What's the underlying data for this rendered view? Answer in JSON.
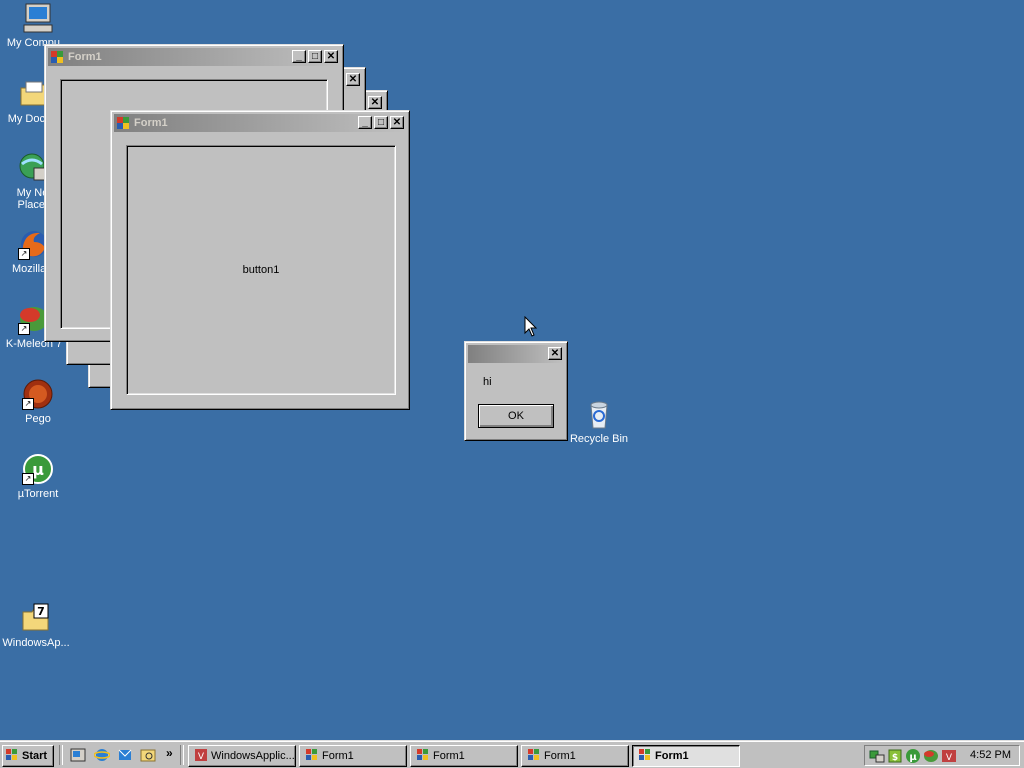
{
  "desktop": {
    "icons": [
      {
        "label": "My Compu..."
      },
      {
        "label": "My Docu..."
      },
      {
        "label": "My Net"
      },
      {
        "label": "Places"
      },
      {
        "label": "Mozilla F"
      },
      {
        "label": "K-Meleon 7"
      },
      {
        "label": "Pego"
      },
      {
        "label": "µTorrent"
      },
      {
        "label": "WindowsAp..."
      },
      {
        "label": "Recycle Bin"
      }
    ]
  },
  "windows": {
    "back_title": "Form1",
    "front_title": "Form1",
    "front_button_label": "button1",
    "controls": {
      "minimize": "_",
      "maximize": "□",
      "close": "✕"
    }
  },
  "dialog": {
    "message": "hi",
    "ok_label": "OK",
    "close": "✕"
  },
  "taskbar": {
    "start_label": "Start",
    "tasks": [
      {
        "label": "WindowsApplic...",
        "active": false
      },
      {
        "label": "Form1",
        "active": false
      },
      {
        "label": "Form1",
        "active": false
      },
      {
        "label": "Form1",
        "active": false
      },
      {
        "label": "Form1",
        "active": true
      }
    ],
    "quicklaunch_more": "»",
    "clock": "4:52 PM"
  },
  "colors": {
    "desktop": "#3a6ea5",
    "window_face": "#c0c0c0",
    "inactive_title": "#808080"
  }
}
